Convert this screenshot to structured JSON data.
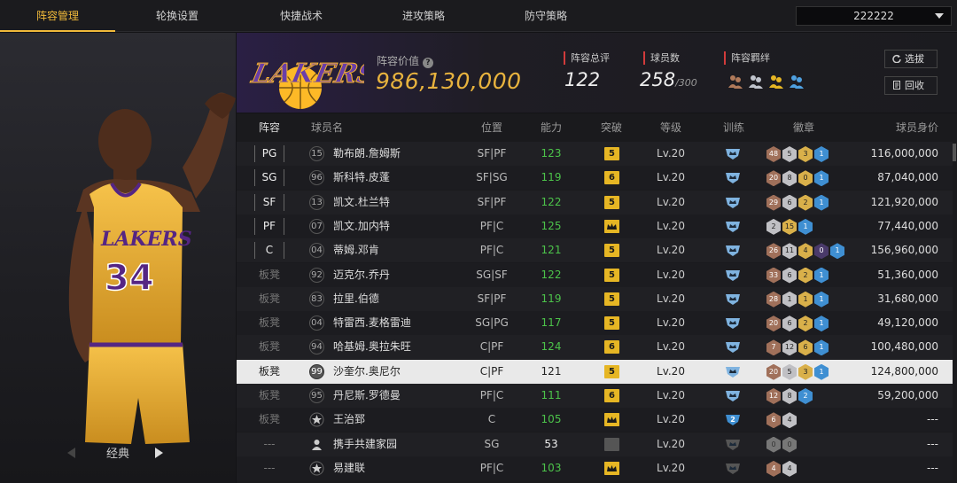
{
  "tabs": [
    "阵容管理",
    "轮换设置",
    "快捷战术",
    "进攻策略",
    "防守策略"
  ],
  "team_select": "222222",
  "left": {
    "mode": "经典"
  },
  "header": {
    "value_label": "阵容价值",
    "value": "986,130,000",
    "rating_label": "阵容总评",
    "rating": "122",
    "players_label": "球员数",
    "players": "258",
    "players_max": "/300",
    "chem_label": "阵容羁绊",
    "btn_select": "选拔",
    "btn_recycle": "回收"
  },
  "columns": [
    "阵容",
    "球员名",
    "位置",
    "能力",
    "突破",
    "等级",
    "训练",
    "徽章",
    "球员身价"
  ],
  "rows": [
    {
      "slot": "PG",
      "num": "15",
      "name": "勒布朗.詹姆斯",
      "pos": "SF|PF",
      "ability": "123",
      "bk": "5",
      "lv": "Lv.20",
      "train": "",
      "badges": [
        "48",
        "5",
        "3",
        "1"
      ],
      "price": "116,000,000"
    },
    {
      "slot": "SG",
      "num": "96",
      "name": "斯科特.皮蓬",
      "pos": "SF|SG",
      "ability": "119",
      "bk": "6",
      "lv": "Lv.20",
      "train": "",
      "badges": [
        "20",
        "8",
        "0",
        "1"
      ],
      "price": "87,040,000"
    },
    {
      "slot": "SF",
      "num": "13",
      "name": "凯文.杜兰特",
      "pos": "SF|PF",
      "ability": "122",
      "bk": "5",
      "lv": "Lv.20",
      "train": "",
      "badges": [
        "29",
        "6",
        "2",
        "1"
      ],
      "price": "121,920,000"
    },
    {
      "slot": "PF",
      "num": "07",
      "name": "凯文.加内特",
      "pos": "PF|C",
      "ability": "125",
      "bk": "",
      "lv": "Lv.20",
      "train": "",
      "badges": [
        "2",
        "15",
        "1"
      ],
      "price": "77,440,000"
    },
    {
      "slot": "C",
      "num": "04",
      "name": "蒂姆.邓肯",
      "pos": "PF|C",
      "ability": "121",
      "bk": "5",
      "lv": "Lv.20",
      "train": "",
      "badges": [
        "26",
        "11",
        "4",
        "0",
        "1"
      ],
      "price": "156,960,000"
    },
    {
      "slot": "板凳",
      "num": "92",
      "name": "迈克尔.乔丹",
      "pos": "SG|SF",
      "ability": "122",
      "bk": "5",
      "lv": "Lv.20",
      "train": "",
      "badges": [
        "33",
        "6",
        "2",
        "1"
      ],
      "price": "51,360,000"
    },
    {
      "slot": "板凳",
      "num": "83",
      "name": "拉里.伯德",
      "pos": "SF|PF",
      "ability": "119",
      "bk": "5",
      "lv": "Lv.20",
      "train": "",
      "badges": [
        "28",
        "1",
        "1",
        "1"
      ],
      "price": "31,680,000"
    },
    {
      "slot": "板凳",
      "num": "04",
      "name": "特雷西.麦格雷迪",
      "pos": "SG|PG",
      "ability": "117",
      "bk": "5",
      "lv": "Lv.20",
      "train": "",
      "badges": [
        "20",
        "6",
        "2",
        "1"
      ],
      "price": "49,120,000"
    },
    {
      "slot": "板凳",
      "num": "94",
      "name": "哈基姆.奥拉朱旺",
      "pos": "C|PF",
      "ability": "124",
      "bk": "6",
      "lv": "Lv.20",
      "train": "",
      "badges": [
        "7",
        "12",
        "6",
        "1"
      ],
      "price": "100,480,000"
    },
    {
      "slot": "板凳",
      "num": "99",
      "name": "沙奎尔.奥尼尔",
      "pos": "C|PF",
      "ability": "121",
      "bk": "5",
      "lv": "Lv.20",
      "train": "",
      "badges": [
        "20",
        "5",
        "3",
        "1"
      ],
      "price": "124,800,000"
    },
    {
      "slot": "板凳",
      "num": "95",
      "name": "丹尼斯.罗德曼",
      "pos": "PF|C",
      "ability": "111",
      "bk": "6",
      "lv": "Lv.20",
      "train": "",
      "badges": [
        "12",
        "8",
        "2"
      ],
      "price": "59,200,000"
    },
    {
      "slot": "板凳",
      "num": "",
      "name": "王治郅",
      "pos": "C",
      "ability": "105",
      "bk": "",
      "lv": "Lv.20",
      "train": "2",
      "badges": [
        "6",
        "4"
      ],
      "price": "---"
    },
    {
      "slot": "---",
      "num": "",
      "name": "携手共建家园",
      "pos": "SG",
      "ability": "53",
      "bk": "",
      "lv": "Lv.20",
      "train": "",
      "badges": [
        "0",
        "0"
      ],
      "price": "---"
    },
    {
      "slot": "---",
      "num": "",
      "name": "易建联",
      "pos": "PF|C",
      "ability": "103",
      "bk": "",
      "lv": "Lv.20",
      "train": "",
      "badges": [
        "4",
        "4"
      ],
      "price": "---"
    }
  ],
  "colors": {
    "accent": "#f0b93a",
    "ability_green": "#4cc34a",
    "lakers_purple": "#552583",
    "lakers_gold": "#fdb927"
  }
}
